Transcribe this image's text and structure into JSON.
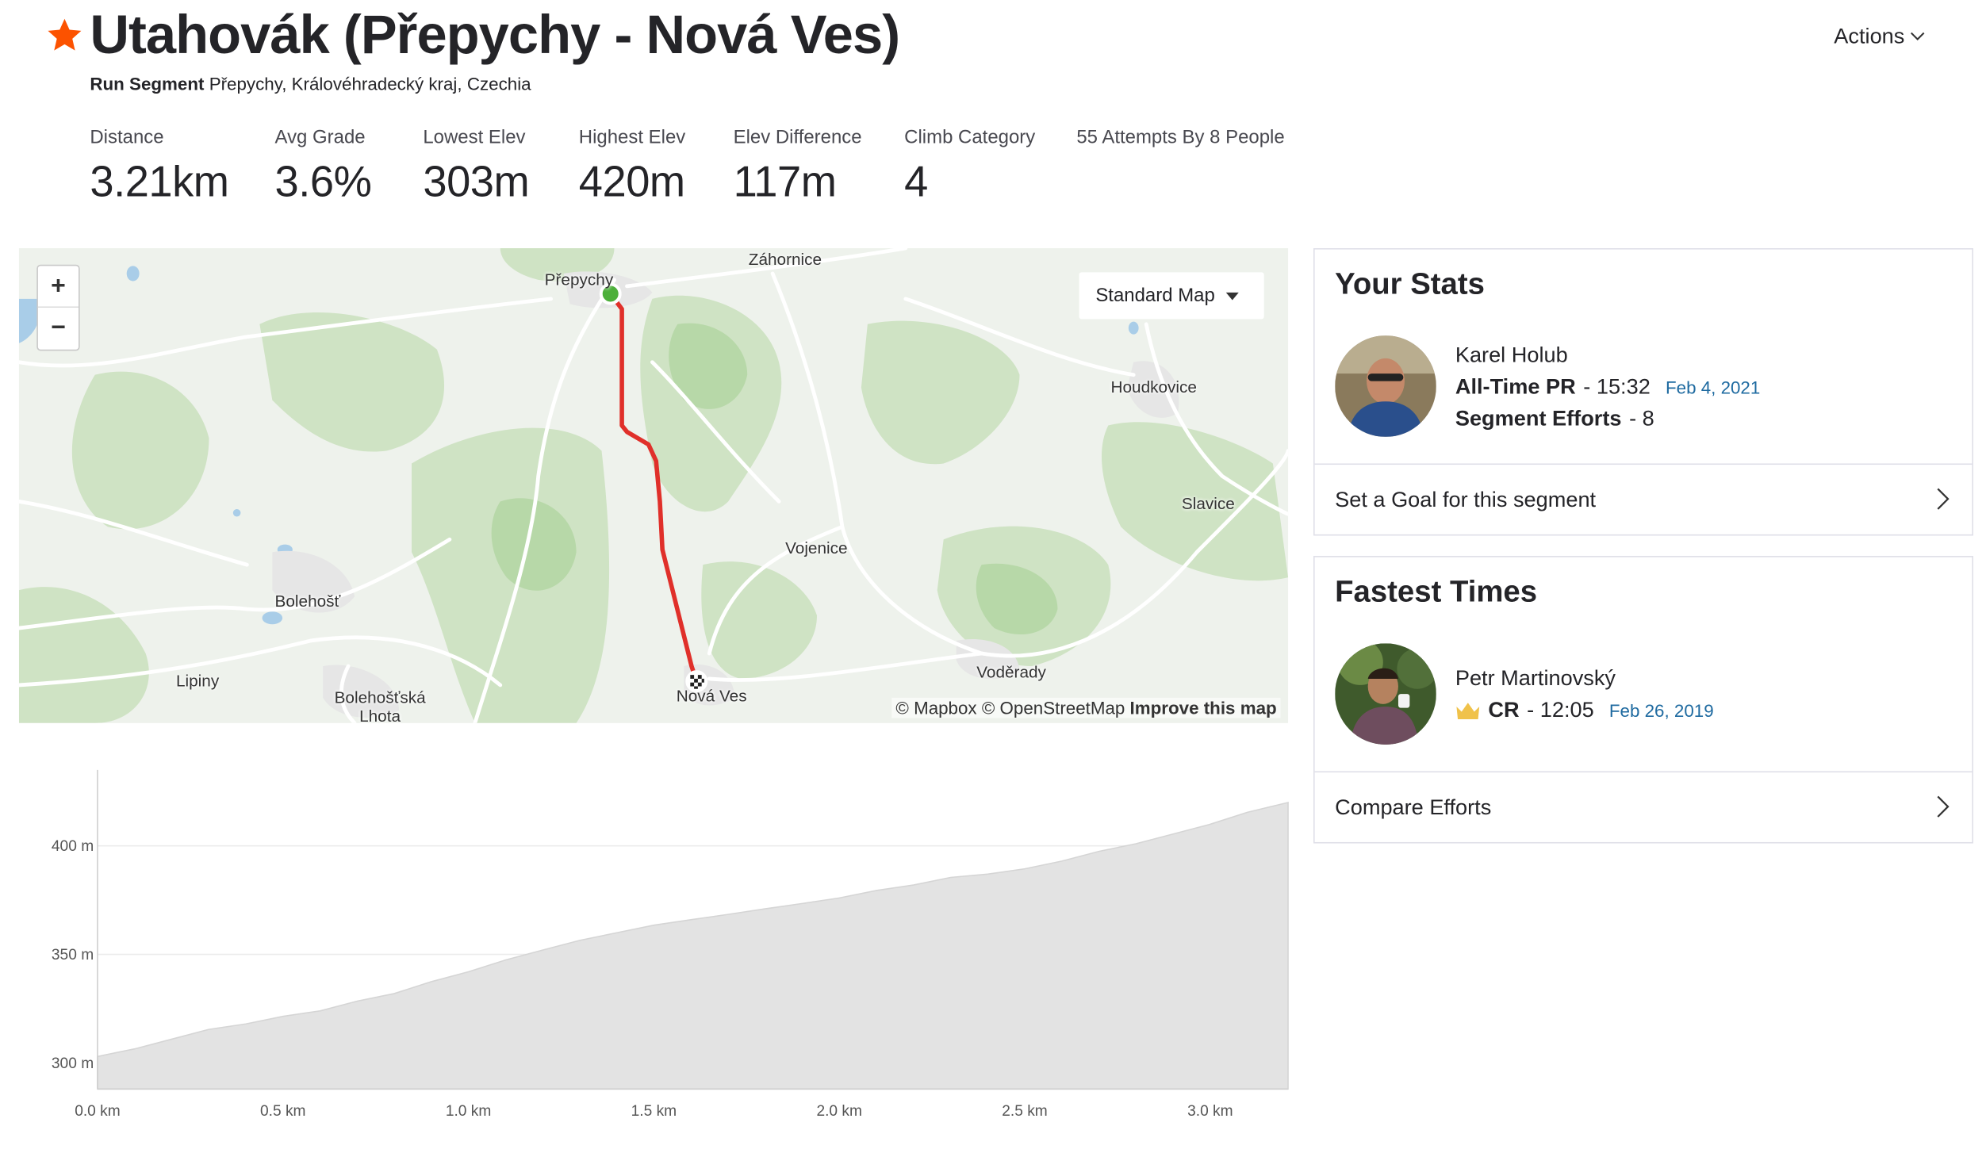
{
  "header": {
    "title": "Utahovák (Přepychy - Nová Ves)",
    "segment_type": "Run Segment",
    "location": "Přepychy, Královéhradecký kraj, Czechia",
    "actions_label": "Actions",
    "star_color": "#fc5200"
  },
  "stats": [
    {
      "label": "Distance",
      "value": "3.21km"
    },
    {
      "label": "Avg Grade",
      "value": "3.6%"
    },
    {
      "label": "Lowest Elev",
      "value": "303m"
    },
    {
      "label": "Highest Elev",
      "value": "420m"
    },
    {
      "label": "Elev Difference",
      "value": "117m"
    },
    {
      "label": "Climb Category",
      "value": "4"
    }
  ],
  "attempts_label": "55 Attempts By 8 People",
  "map": {
    "zoom_in": "+",
    "zoom_out": "−",
    "map_type": "Standard Map",
    "attribution_mapbox": "© Mapbox",
    "attribution_osm": "© OpenStreetMap",
    "attribution_improve": "Improve this map",
    "places": [
      "Záhornice",
      "Přepychy",
      "Houdkovice",
      "Slavice",
      "Vojenice",
      "Bolehošť",
      "Voděrady",
      "Lipiny",
      "Bolehošťská Lhota",
      "Nová Ves"
    ],
    "route_color": "#e0302a",
    "start_color": "#4caf3a"
  },
  "your_stats": {
    "title": "Your Stats",
    "athlete": "Karel Holub",
    "pr_label": "All-Time PR",
    "pr_value": "- 15:32",
    "pr_date": "Feb 4, 2021",
    "efforts_label": "Segment Efforts",
    "efforts_value": "- 8",
    "goal_link": "Set a Goal for this segment"
  },
  "fastest_times": {
    "title": "Fastest Times",
    "athlete": "Petr Martinovský",
    "cr_label": "CR",
    "cr_value": "- 12:05",
    "cr_date": "Feb 26, 2019",
    "compare_link": "Compare Efforts",
    "crown_color": "#f0c24a"
  },
  "chart_data": {
    "type": "area",
    "xlabel": "",
    "ylabel": "",
    "x_ticks": [
      "0.0 km",
      "0.5 km",
      "1.0 km",
      "1.5 km",
      "2.0 km",
      "2.5 km",
      "3.0 km"
    ],
    "y_ticks": [
      "300 m",
      "350 m",
      "400 m"
    ],
    "xlim": [
      0,
      3.21
    ],
    "ylim": [
      288,
      435
    ],
    "grid": true,
    "fill_color": "#e3e3e3",
    "series": [
      {
        "x": [
          0,
          0.1,
          0.2,
          0.3,
          0.4,
          0.5,
          0.6,
          0.7,
          0.8,
          0.9,
          1.0,
          1.1,
          1.2,
          1.3,
          1.4,
          1.5,
          1.6,
          1.7,
          1.8,
          1.9,
          2.0,
          2.1,
          2.2,
          2.3,
          2.4,
          2.5,
          2.6,
          2.7,
          2.8,
          2.9,
          3.0,
          3.1,
          3.21
        ],
        "y": [
          303,
          306,
          311,
          315,
          318,
          321,
          324,
          328,
          332,
          337,
          342,
          347,
          352,
          356,
          360,
          363,
          366,
          368,
          371,
          373,
          376,
          379,
          382,
          385,
          387,
          389,
          393,
          397,
          401,
          405,
          410,
          415,
          420
        ]
      }
    ]
  }
}
